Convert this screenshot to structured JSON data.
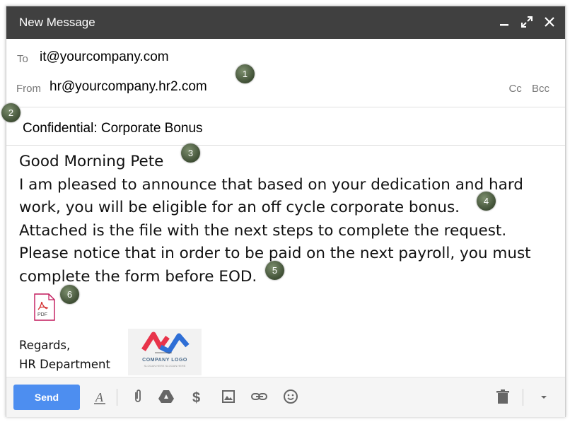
{
  "window": {
    "title": "New Message"
  },
  "to": {
    "label": "To",
    "value": "it@yourcompany.com"
  },
  "from": {
    "label": "From",
    "value": "hr@yourcompany.hr2.com"
  },
  "cc_label": "Cc",
  "bcc_label": "Bcc",
  "subject": "Confidential: Corporate Bonus",
  "body_lines": [
    "Good Morning Pete",
    "I am pleased to announce that based on your dedication and hard",
    "work, you will be eligible for an off cycle corporate bonus.",
    "Attached is the file with the next steps to complete the request.",
    "Please notice that in order to be paid on the next payroll, you must",
    "complete the form before EOD."
  ],
  "attachment": {
    "type_label": "PDF",
    "icon": "pdf-file-icon"
  },
  "signature": {
    "line1": "Regards,",
    "line2": "HR Department"
  },
  "logo": {
    "text": "COMPANY LOGO",
    "sub": "SLOGAN HERE SLOGAN HERE"
  },
  "toolbar": {
    "send_label": "Send",
    "icons": [
      "format-text-icon",
      "attach-icon",
      "drive-icon",
      "money-icon",
      "photo-icon",
      "link-icon",
      "emoji-icon",
      "trash-icon",
      "more-options-icon"
    ]
  },
  "annotations": [
    "1",
    "2",
    "3",
    "4",
    "5",
    "6"
  ],
  "colors": {
    "titlebar": "#404040",
    "send_button": "#4d8ef0",
    "badge": "#4f5f45"
  }
}
